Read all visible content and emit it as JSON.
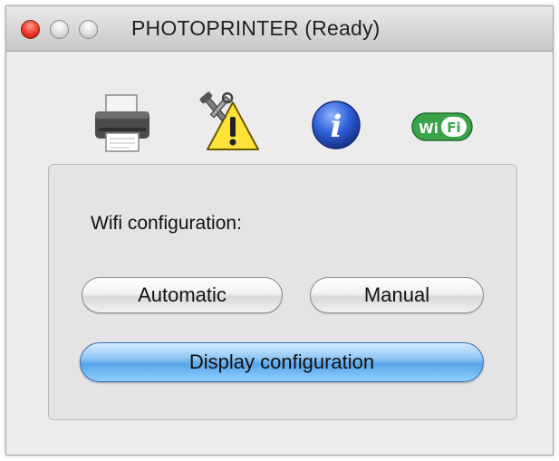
{
  "window": {
    "title": "PHOTOPRINTER (Ready)",
    "controls": [
      "close-button",
      "minimize-button",
      "zoom-button"
    ]
  },
  "toolbar": {
    "items": [
      {
        "icon": "printer-icon"
      },
      {
        "icon": "tools-warning-icon"
      },
      {
        "icon": "info-icon",
        "glyph": "i"
      },
      {
        "icon": "wifi-icon",
        "glyph": "WiFi"
      }
    ]
  },
  "panel": {
    "label": "Wifi configuration:",
    "buttons": {
      "automatic": "Automatic",
      "manual": "Manual",
      "display": "Display configuration"
    }
  },
  "colors": {
    "close": "#e83a2c",
    "primary_button": "#5aa6ea",
    "window_bg": "#ececec"
  }
}
